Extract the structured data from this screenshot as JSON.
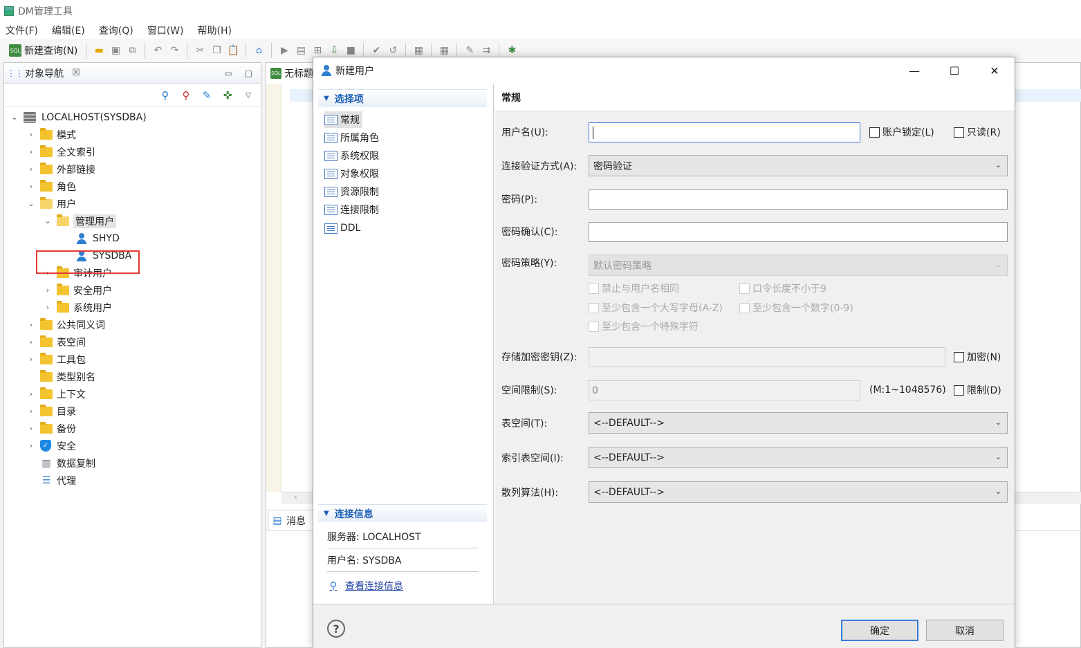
{
  "app": {
    "title": "DM管理工具"
  },
  "menu": [
    "文件(F)",
    "编辑(E)",
    "查询(Q)",
    "窗口(W)",
    "帮助(H)"
  ],
  "toolbar": {
    "new_query": "新建查询(N)"
  },
  "nav": {
    "tab_label": "对象导航",
    "root": "LOCALHOST(SYSDBA)",
    "items": {
      "schema": "模式",
      "fulltext": "全文索引",
      "dblink": "外部链接",
      "role": "角色",
      "user": "用户",
      "admin_user": "管理用户",
      "shyd": "SHYD",
      "sysdba": "SYSDBA",
      "audit_user": "审计用户",
      "security_user": "安全用户",
      "system_user": "系统用户",
      "synonym": "公共同义词",
      "tablespace": "表空间",
      "package": "工具包",
      "type_alias": "类型别名",
      "context": "上下文",
      "directory": "目录",
      "backup": "备份",
      "security": "安全",
      "replication": "数据复制",
      "agent": "代理"
    }
  },
  "editor": {
    "tab_label": "无标题",
    "msg_tab": "消息"
  },
  "dialog": {
    "title": "新建用户",
    "options_header": "选择项",
    "options": [
      "常规",
      "所属角色",
      "系统权限",
      "对象权限",
      "资源限制",
      "连接限制",
      "DDL"
    ],
    "conn_header": "连接信息",
    "server": "服务器: LOCALHOST",
    "username_info": "用户名: SYSDBA",
    "view_conn": "查看连接信息",
    "section_title": "常规",
    "fields": {
      "username_label": "用户名(U):",
      "username_value": "",
      "lock_label": "账户锁定(L)",
      "readonly_label": "只读(R)",
      "auth_label": "连接验证方式(A):",
      "auth_value": "密码验证",
      "password_label": "密码(P):",
      "confirm_label": "密码确认(C):",
      "policy_label": "密码策略(Y):",
      "policy_value": "默认密码策略",
      "policy_opts": [
        "禁止与用户名相同",
        "口令长度不小于9",
        "至少包含一个大写字母(A-Z)",
        "至少包含一个数字(0-9)",
        "至少包含一个特殊字符"
      ],
      "encrypt_key_label": "存储加密密钥(Z):",
      "encrypt_label": "加密(N)",
      "space_label": "空间限制(S):",
      "space_value": "0",
      "space_range": "(M:1~1048576)",
      "limit_label": "限制(D)",
      "tablespace_label": "表空间(T):",
      "tablespace_value": "<--DEFAULT-->",
      "idx_tablespace_label": "索引表空间(I):",
      "idx_tablespace_value": "<--DEFAULT-->",
      "hash_label": "散列算法(H):",
      "hash_value": "<--DEFAULT-->"
    },
    "ok": "确定",
    "cancel": "取消",
    "help": "?"
  }
}
